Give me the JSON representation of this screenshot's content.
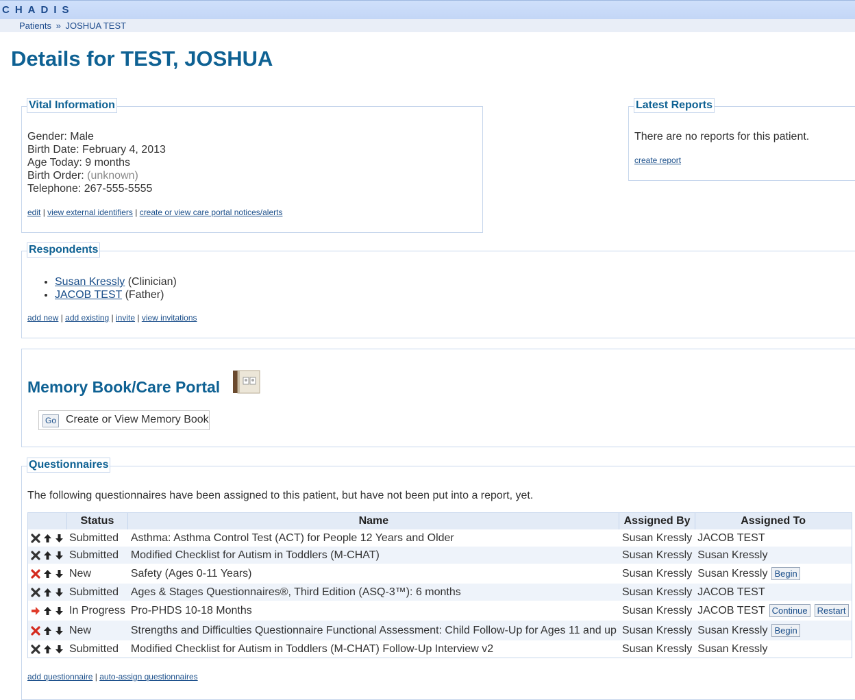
{
  "app": {
    "logo": "CHADIS"
  },
  "breadcrumb": {
    "root": "Patients",
    "separator": "»",
    "current": "JOSHUA TEST"
  },
  "page": {
    "title": "Details for TEST, JOSHUA"
  },
  "vital": {
    "legend": "Vital Information",
    "gender_label": "Gender:",
    "gender": "Male",
    "birth_date_label": "Birth Date:",
    "birth_date": "February 4, 2013",
    "age_label": "Age Today:",
    "age": "9 months",
    "birth_order_label": "Birth Order:",
    "birth_order": "(unknown)",
    "telephone_label": "Telephone:",
    "telephone": "267-555-5555",
    "links": {
      "edit": "edit",
      "external_ids": "view external identifiers",
      "notices": "create or view care portal notices/alerts"
    }
  },
  "reports": {
    "legend": "Latest Reports",
    "empty_text": "There are no reports for this patient.",
    "create_link": "create report"
  },
  "respondents": {
    "legend": "Respondents",
    "items": [
      {
        "name": "Susan Kressly",
        "role": "(Clinician)"
      },
      {
        "name": "JACOB TEST",
        "role": "(Father)"
      }
    ],
    "links": {
      "add_new": "add new",
      "add_existing": "add existing",
      "invite": "invite",
      "view_invitations": "view invitations"
    }
  },
  "memory_book": {
    "title": "Memory Book/Care Portal",
    "go_label": "Go",
    "action_label": "Create or View Memory Book",
    "icon": "memory-book-icon"
  },
  "questionnaires": {
    "legend": "Questionnaires",
    "intro": "The following questionnaires have been assigned to this patient, but have not been put into a report, yet.",
    "columns": {
      "status": "Status",
      "name": "Name",
      "assigned_by": "Assigned By",
      "assigned_to": "Assigned To"
    },
    "colors": {
      "delete_dark": "#333333",
      "delete_red": "#d42a1e",
      "in_progress": "#e03b2a"
    },
    "rows": [
      {
        "status": "Submitted",
        "name": "Asthma: Asthma Control Test (ACT) for People 12 Years and Older",
        "assigned_by": "Susan Kressly",
        "assigned_to": "JACOB TEST",
        "action_icon": "delete-icon-dark",
        "buttons": []
      },
      {
        "status": "Submitted",
        "name": "Modified Checklist for Autism in Toddlers (M-CHAT)",
        "assigned_by": "Susan Kressly",
        "assigned_to": "Susan Kressly",
        "action_icon": "delete-icon-dark",
        "buttons": []
      },
      {
        "status": "New",
        "name": "Safety (Ages 0-11 Years)",
        "assigned_by": "Susan Kressly",
        "assigned_to": "Susan Kressly",
        "action_icon": "delete-icon-red",
        "buttons": [
          "Begin"
        ]
      },
      {
        "status": "Submitted",
        "name": "Ages & Stages Questionnaires®, Third Edition (ASQ-3™): 6 months",
        "assigned_by": "Susan Kressly",
        "assigned_to": "JACOB TEST",
        "action_icon": "delete-icon-dark",
        "buttons": []
      },
      {
        "status": "In Progress",
        "name": "Pro-PHDS 10-18 Months",
        "assigned_by": "Susan Kressly",
        "assigned_to": "JACOB TEST",
        "action_icon": "in-progress-arrow-icon",
        "buttons": [
          "Continue",
          "Restart"
        ]
      },
      {
        "status": "New",
        "name": "Strengths and Difficulties Questionnaire Functional Assessment: Child Follow-Up for Ages 11 and up",
        "assigned_by": "Susan Kressly",
        "assigned_to": "Susan Kressly",
        "action_icon": "delete-icon-red",
        "buttons": [
          "Begin"
        ]
      },
      {
        "status": "Submitted",
        "name": "Modified Checklist for Autism in Toddlers (M-CHAT) Follow-Up Interview v2",
        "assigned_by": "Susan Kressly",
        "assigned_to": "Susan Kressly",
        "action_icon": "delete-icon-dark",
        "buttons": []
      }
    ],
    "links": {
      "add": "add questionnaire",
      "auto_assign": "auto-assign questionnaires"
    }
  }
}
